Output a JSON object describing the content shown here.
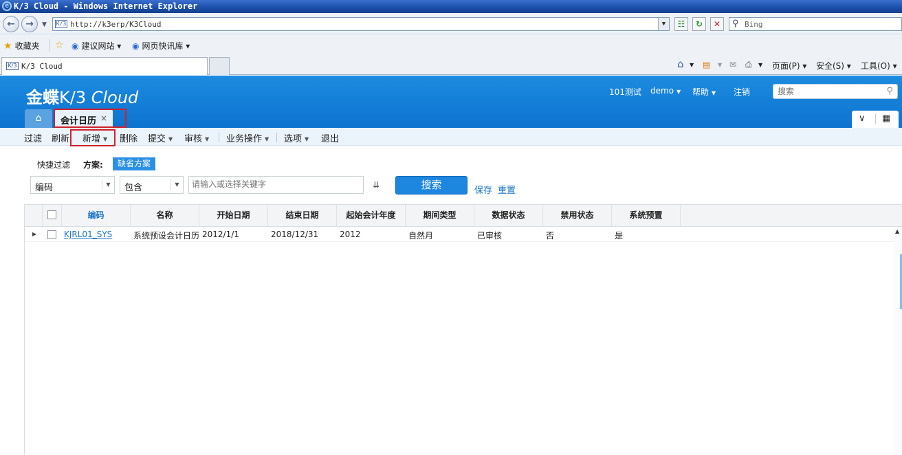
{
  "browser": {
    "title": "K/3 Cloud - Windows Internet Explorer",
    "address": "http://k3erp/K3Cloud",
    "search_placeholder": "Bing",
    "favorites_label": "收藏夹",
    "fav_links": [
      "建议网站 ▾",
      "网页快讯库 ▾"
    ],
    "tab_title": "K/3 Cloud",
    "commands": {
      "page": "页面(P) ▾",
      "safety": "安全(S) ▾",
      "tools": "工具(O) ▾"
    }
  },
  "app": {
    "logo_cn": "金蝶",
    "logo_k3": "K/3",
    "logo_cloud": "Cloud",
    "header": {
      "org": "101测试",
      "user": "demo",
      "help": "帮助",
      "logout": "注销",
      "search_placeholder": "搜索"
    },
    "tabs": {
      "home_icon": "home-icon",
      "active_tab": "会计日历",
      "close": "×"
    }
  },
  "toolbar": {
    "items": [
      {
        "label": "过滤",
        "dropdown": false
      },
      {
        "label": "刷新",
        "dropdown": false
      },
      {
        "label": "新增",
        "dropdown": true
      },
      {
        "label": "删除",
        "dropdown": false
      },
      {
        "label": "提交",
        "dropdown": true
      },
      {
        "label": "审核",
        "dropdown": true
      },
      {
        "label": "业务操作",
        "dropdown": true
      },
      {
        "label": "选项",
        "dropdown": true
      },
      {
        "label": "退出",
        "dropdown": false
      }
    ],
    "arrow": "▼"
  },
  "filter": {
    "quick_filter": "快捷过滤",
    "scheme_label": "方案:",
    "scheme_value": "缺省方案",
    "field": "编码",
    "operator": "包含",
    "keyword_placeholder": "请输入或选择关键字",
    "search_button": "搜索",
    "save": "保存",
    "reset": "重置"
  },
  "grid": {
    "columns": [
      "编码",
      "名称",
      "开始日期",
      "结束日期",
      "起始会计年度",
      "期间类型",
      "数据状态",
      "禁用状态",
      "系统预置"
    ],
    "rows": [
      [
        "KJRL01_SYS",
        "系统预设会计日历",
        "2012/1/1",
        "2018/12/31",
        "2012",
        "自然月",
        "已审核",
        "否",
        "是"
      ]
    ]
  },
  "colors": {
    "accent": "#1d86de",
    "header_bg": "#0d73cf",
    "highlight_box": "#d0202a"
  }
}
